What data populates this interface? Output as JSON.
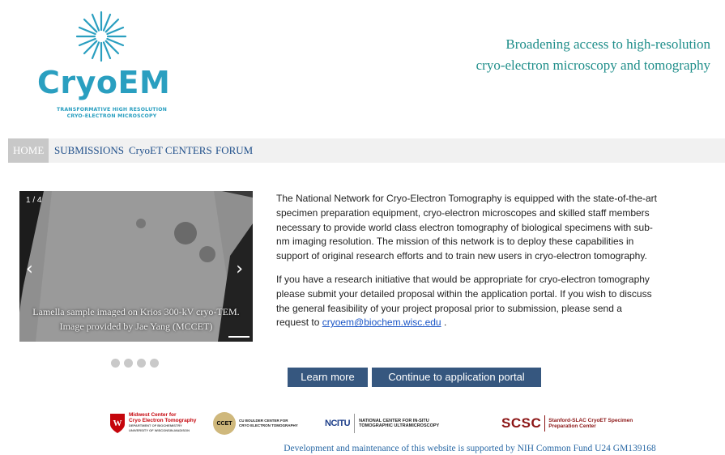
{
  "header": {
    "logo_word": "CryoEM",
    "logo_subtitle_line1": "TRANSFORMATIVE HIGH RESOLUTION",
    "logo_subtitle_line2": "CRYO-ELECTRON MICROSCOPY",
    "tagline_line1": "Broadening access to high-resolution",
    "tagline_line2": "cryo-electron microscopy and tomography",
    "brand_color": "#2a9fc0",
    "tagline_color": "#1f8e8a"
  },
  "nav": {
    "items": [
      {
        "label": "HOME",
        "active": true
      },
      {
        "label": "SUBMISSIONS",
        "active": false
      },
      {
        "label": "CryoET CENTERS",
        "active": false
      },
      {
        "label": "FORUM",
        "active": false
      }
    ]
  },
  "carousel": {
    "counter": "1 / 4",
    "caption_line1": "Lamella sample imaged on Krios 300-kV cryo-TEM.",
    "caption_line2": "Image provided by Jae Yang (MCCET)",
    "slide_count": 4,
    "active_index": 0,
    "prev_icon": "chevron-left-icon",
    "next_icon": "chevron-right-icon"
  },
  "intro": {
    "paragraph1": "The National Network for Cryo-Electron Tomography is equipped with the state-of-the-art specimen preparation equipment, cryo-electron microscopes and skilled staff members necessary to provide world class electron tomography of biological specimens with sub-nm imaging resolution. The mission of this network is to deploy these capabilities in support of original research efforts and to train new users in cryo-electron tomography.",
    "paragraph2_before": "If you have a research initiative that would be appropriate for cryo-electron tomography please submit your detailed proposal within the application portal. If you wish to discuss the general feasibility of your project proposal prior to submission, please send a request to ",
    "email": "cryoem@biochem.wisc.edu",
    "paragraph2_after": " ."
  },
  "buttons": {
    "learn_more": "Learn more",
    "portal": "Continue to application portal",
    "color": "#36577f"
  },
  "partners": {
    "mccet_line1": "Midwest Center for",
    "mccet_line2": "Cryo Electron Tomography",
    "mccet_line3": "DEPARTMENT OF BIOCHEMISTRY",
    "mccet_line4": "UNIVERSITY OF WISCONSIN-MADISON",
    "ccet_badge": "CCET",
    "ccet_line1": "CU BOULDER CENTER FOR",
    "ccet_line2": "CRYO ELECTRON TOMOGRAPHY",
    "ncitu_badge": "NCITU",
    "ncitu_line1": "NATIONAL CENTER FOR IN-SITU",
    "ncitu_line2": "TOMOGRAPHIC ULTRAMICROSCOPY",
    "scsc_badge": "SCSC",
    "scsc_line1": "Stanford-SLAC CryoET Specimen",
    "scsc_line2": "Preparation Center"
  },
  "footer": {
    "text": "Development and maintenance of this website is supported by NIH Common Fund U24 GM139168"
  }
}
